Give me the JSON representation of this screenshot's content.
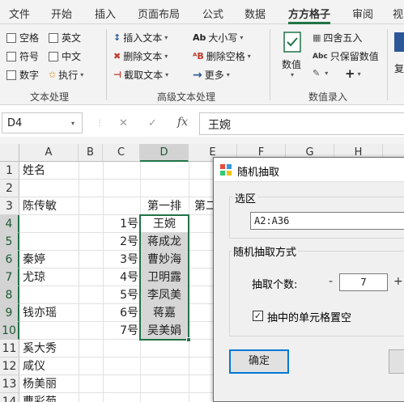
{
  "menu": {
    "tabs": [
      "文件",
      "开始",
      "插入",
      "页面布局",
      "公式",
      "数据",
      "方方格子",
      "审阅",
      "视"
    ],
    "active": "方方格子"
  },
  "ribbon": {
    "text_group": {
      "checkboxes": [
        "空格",
        "英文",
        "符号",
        "中文",
        "数字"
      ],
      "execute": "执行",
      "label": "文本处理"
    },
    "advanced_group": {
      "insert": "插入文本",
      "delete": "删除文本",
      "extract": "截取文本",
      "case": "大小写",
      "remove_space": "删除空格",
      "more": "更多",
      "label": "高级文本处理",
      "case_icon": "Ab",
      "space_icon": "ᴬB"
    },
    "numeric_group": {
      "numeric": "数值",
      "round": "四舍五入",
      "keep_value": "只保留数值",
      "label": "数值录入",
      "keep_icon": "Abc",
      "plus": "+"
    },
    "partial": "复"
  },
  "formula_bar": {
    "name_box": "D4",
    "formula": "王婉",
    "fx": "fx"
  },
  "columns": [
    "A",
    "B",
    "C",
    "D",
    "E",
    "F",
    "G",
    "H"
  ],
  "rows": [
    "1",
    "2",
    "3",
    "4",
    "5",
    "6",
    "7",
    "8",
    "9",
    "10",
    "11",
    "12",
    "13",
    "14"
  ],
  "cells": {
    "A1": "姓名",
    "A3": "陈传敏",
    "A6": "秦婷",
    "A7": "尤琼",
    "A9": "钱亦瑶",
    "A11": "奚大秀",
    "A12": "咸仪",
    "A13": "杨美丽",
    "A14": "曹彩菊",
    "C4": "1号",
    "C5": "2号",
    "C6": "3号",
    "C7": "4号",
    "C8": "5号",
    "C9": "6号",
    "C10": "7号",
    "D3": "第一排",
    "D4": "王婉",
    "D5": "蒋成龙",
    "D6": "曹妙海",
    "D7": "卫明露",
    "D8": "李凤美",
    "D9": "蒋嘉",
    "D10": "吴美娟",
    "E3": "第二"
  },
  "dialog": {
    "title": "随机抽取",
    "range_label": "选区",
    "range_value": "A2:A36",
    "method_label": "随机抽取方式",
    "count_label": "抽取个数:",
    "count_value": "7",
    "minus": "-",
    "plus": "+",
    "clear_label": "抽中的单元格置空",
    "clear_checked": true,
    "ok": "确定"
  }
}
